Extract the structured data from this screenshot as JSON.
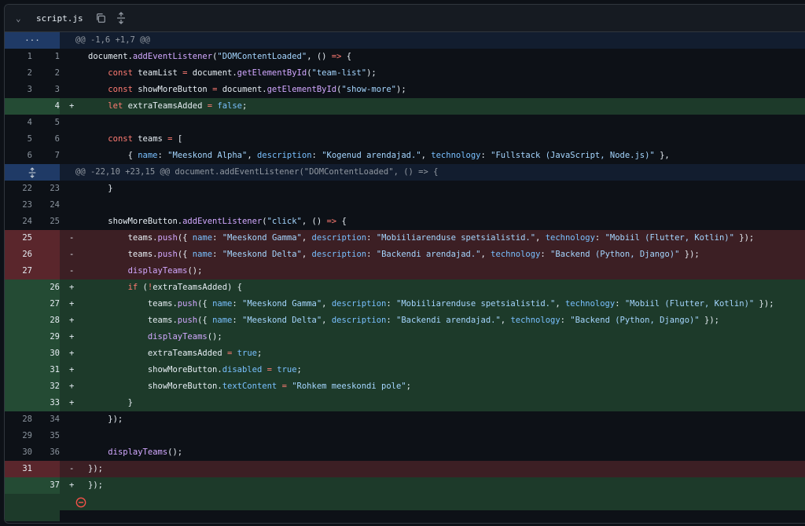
{
  "file": {
    "name": "script.js"
  },
  "hunks": [
    {
      "lnlabel": "···",
      "text": "@@ -1,6 +1,7 @@"
    },
    {
      "text": "@@ -22,10 +23,15 @@ document.addEventListener(\"DOMContentLoaded\", () => {"
    }
  ],
  "lines": [
    {
      "o": "1",
      "n": "1",
      "sign": "",
      "t": "ctx",
      "code": "document.addEventListener(\"DOMContentLoaded\", () => {"
    },
    {
      "o": "2",
      "n": "2",
      "sign": "",
      "t": "ctx",
      "code": "    const teamList = document.getElementById(\"team-list\");"
    },
    {
      "o": "3",
      "n": "3",
      "sign": "",
      "t": "ctx",
      "code": "    const showMoreButton = document.getElementById(\"show-more\");"
    },
    {
      "o": "",
      "n": "4",
      "sign": "+",
      "t": "add",
      "code": "    let extraTeamsAdded = false;"
    },
    {
      "o": "4",
      "n": "5",
      "sign": "",
      "t": "ctx",
      "code": ""
    },
    {
      "o": "5",
      "n": "6",
      "sign": "",
      "t": "ctx",
      "code": "    const teams = ["
    },
    {
      "o": "6",
      "n": "7",
      "sign": "",
      "t": "ctx",
      "code": "        { name: \"Meeskond Alpha\", description: \"Kogenud arendajad.\", technology: \"Fullstack (JavaScript, Node.js)\" },"
    },
    {
      "o": "22",
      "n": "23",
      "sign": "",
      "t": "ctx",
      "code": "    }"
    },
    {
      "o": "23",
      "n": "24",
      "sign": "",
      "t": "ctx",
      "code": ""
    },
    {
      "o": "24",
      "n": "25",
      "sign": "",
      "t": "ctx",
      "code": "    showMoreButton.addEventListener(\"click\", () => {"
    },
    {
      "o": "25",
      "n": "",
      "sign": "-",
      "t": "del",
      "code": "        teams.push({ name: \"Meeskond Gamma\", description: \"Mobiiliarenduse spetsialistid.\", technology: \"Mobiil (Flutter, Kotlin)\" });"
    },
    {
      "o": "26",
      "n": "",
      "sign": "-",
      "t": "del",
      "code": "        teams.push({ name: \"Meeskond Delta\", description: \"Backendi arendajad.\", technology: \"Backend (Python, Django)\" });"
    },
    {
      "o": "27",
      "n": "",
      "sign": "-",
      "t": "del",
      "code": "        displayTeams();"
    },
    {
      "o": "",
      "n": "26",
      "sign": "+",
      "t": "add",
      "code": "        if (!extraTeamsAdded) {"
    },
    {
      "o": "",
      "n": "27",
      "sign": "+",
      "t": "add",
      "code": "            teams.push({ name: \"Meeskond Gamma\", description: \"Mobiiliarenduse spetsialistid.\", technology: \"Mobiil (Flutter, Kotlin)\" });"
    },
    {
      "o": "",
      "n": "28",
      "sign": "+",
      "t": "add",
      "code": "            teams.push({ name: \"Meeskond Delta\", description: \"Backendi arendajad.\", technology: \"Backend (Python, Django)\" });"
    },
    {
      "o": "",
      "n": "29",
      "sign": "+",
      "t": "add",
      "code": "            displayTeams();"
    },
    {
      "o": "",
      "n": "30",
      "sign": "+",
      "t": "add",
      "code": "            extraTeamsAdded = true;"
    },
    {
      "o": "",
      "n": "31",
      "sign": "+",
      "t": "add",
      "code": "            showMoreButton.disabled = true;"
    },
    {
      "o": "",
      "n": "32",
      "sign": "+",
      "t": "add",
      "code": "            showMoreButton.textContent = \"Rohkem meeskondi pole\";"
    },
    {
      "o": "",
      "n": "33",
      "sign": "+",
      "t": "add",
      "code": "        }"
    },
    {
      "o": "28",
      "n": "34",
      "sign": "",
      "t": "ctx",
      "code": "    });"
    },
    {
      "o": "29",
      "n": "35",
      "sign": "",
      "t": "ctx",
      "code": ""
    },
    {
      "o": "30",
      "n": "36",
      "sign": "",
      "t": "ctx",
      "code": "    displayTeams();"
    },
    {
      "o": "31",
      "n": "",
      "sign": "-",
      "t": "del",
      "code": "});"
    },
    {
      "o": "",
      "n": "37",
      "sign": "+",
      "t": "add",
      "code": "});"
    }
  ],
  "colors": {
    "add_bg": "#1d3a2a",
    "del_bg": "#3c1f24",
    "hunk_bg": "#121d2f"
  }
}
